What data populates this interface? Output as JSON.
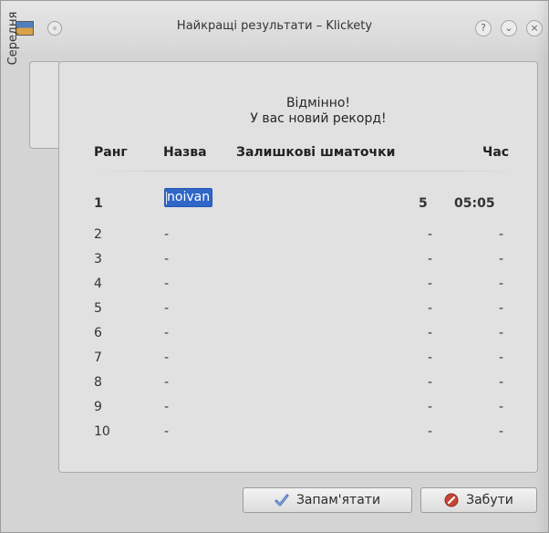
{
  "window": {
    "title": "Найкращі результати – Klickety",
    "buttons": {
      "help_glyph": "?",
      "minimize_glyph": "⌄",
      "close_glyph": "×"
    }
  },
  "tabs": [
    {
      "label": "Середня",
      "selected": true
    }
  ],
  "message": {
    "line1": "Відмінно!",
    "line2": "У вас новий рекорд!"
  },
  "table": {
    "headers": {
      "rank": "Ранг",
      "name": "Назва",
      "remaining": "Залишкові шматочки",
      "time": "Час"
    },
    "rows": [
      {
        "rank": "1",
        "name": "noivan",
        "remaining": "5",
        "time": "05:05",
        "highlight": true
      },
      {
        "rank": "2",
        "name": "-",
        "remaining": "-",
        "time": "-"
      },
      {
        "rank": "3",
        "name": "-",
        "remaining": "-",
        "time": "-"
      },
      {
        "rank": "4",
        "name": "-",
        "remaining": "-",
        "time": "-"
      },
      {
        "rank": "5",
        "name": "-",
        "remaining": "-",
        "time": "-"
      },
      {
        "rank": "6",
        "name": "-",
        "remaining": "-",
        "time": "-"
      },
      {
        "rank": "7",
        "name": "-",
        "remaining": "-",
        "time": "-"
      },
      {
        "rank": "8",
        "name": "-",
        "remaining": "-",
        "time": "-"
      },
      {
        "rank": "9",
        "name": "-",
        "remaining": "-",
        "time": "-"
      },
      {
        "rank": "10",
        "name": "-",
        "remaining": "-",
        "time": "-"
      }
    ]
  },
  "buttons": {
    "remember": {
      "label": "Запам'ятати",
      "icon": "check-icon"
    },
    "forget": {
      "label": "Забути",
      "icon": "forbid-icon"
    }
  },
  "colors": {
    "selection_bg": "#2f66c8",
    "selection_text": "#ffffff",
    "panel_bg": "#e1e1e1",
    "window_bg": "#d4d4d4",
    "forget_icon_red": "#c74533",
    "check_icon_blue": "#426cb8"
  }
}
